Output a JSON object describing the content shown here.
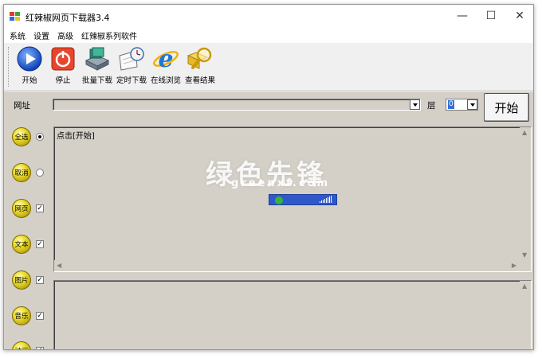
{
  "window": {
    "title": "红辣椒网页下载器3.4",
    "controls": {
      "minimize": "—",
      "maximize": "☐",
      "close": "✕"
    }
  },
  "menu": [
    "系统",
    "设置",
    "高级",
    "红辣椒系列软件"
  ],
  "toolbar": [
    {
      "label": "开始",
      "icon": "play-icon"
    },
    {
      "label": "停止",
      "icon": "power-icon"
    },
    {
      "label": "批量下载",
      "icon": "batch-download-icon"
    },
    {
      "label": "定时下载",
      "icon": "scheduled-download-icon"
    },
    {
      "label": "在线浏览",
      "icon": "ie-browser-icon"
    },
    {
      "label": "查看结果",
      "icon": "magnifier-folder-icon"
    }
  ],
  "address": {
    "label": "网址",
    "value": "",
    "level_label": "层",
    "level_value": "0",
    "start_button": "开始"
  },
  "side_options": [
    {
      "label": "全选",
      "control": "radio",
      "checked": true
    },
    {
      "label": "取消",
      "control": "radio",
      "checked": false
    },
    {
      "label": "网页",
      "control": "checkbox",
      "checked": true
    },
    {
      "label": "文本",
      "control": "checkbox",
      "checked": true
    },
    {
      "label": "图片",
      "control": "checkbox",
      "checked": true
    },
    {
      "label": "音乐",
      "control": "checkbox",
      "checked": true
    },
    {
      "label": "动画",
      "control": "checkbox",
      "checked": true
    }
  ],
  "log_panel": {
    "text": "点击[开始]"
  },
  "watermark": {
    "text": "绿色先锋",
    "url": "greenxf.com"
  },
  "colors": {
    "accent": "#3470d6",
    "panel_bg": "#d4d0c8",
    "ball": "#e8d820"
  }
}
